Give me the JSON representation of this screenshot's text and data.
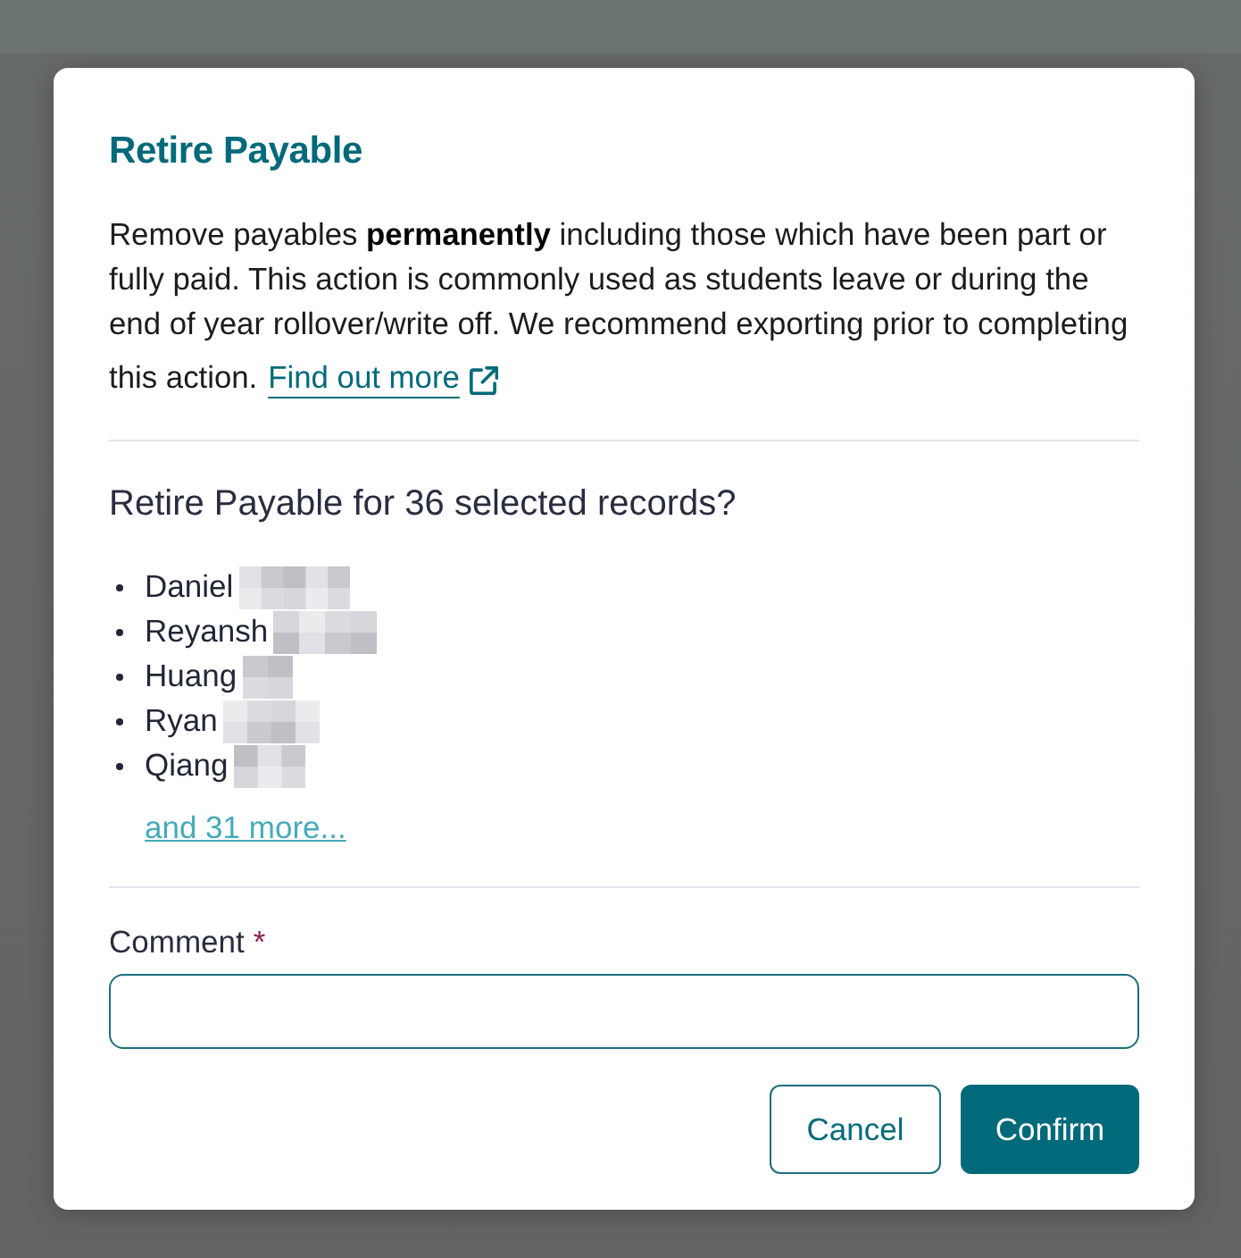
{
  "dialog": {
    "title": "Retire Payable",
    "description": "Remove payables **permanently** including those which have been part or fully paid. This action is commonly used as students leave or during the end of year rollover/write off. We recommend exporting prior to completing this action.",
    "link": {
      "label": "Find out more",
      "external": true
    },
    "question": "Retire Payable for 36 selected records?",
    "records": [
      {
        "name": "Daniel",
        "redacted": true
      },
      {
        "name": "Reyansh",
        "redacted": true
      },
      {
        "name": "Huang",
        "redacted": true
      },
      {
        "name": "Ryan",
        "redacted": true
      },
      {
        "name": "Qiang",
        "redacted": true
      }
    ],
    "more_link": "and 31 more...",
    "comment": {
      "label": "Comment",
      "required_mark": "*"
    },
    "buttons": [
      {
        "label": "Cancel",
        "kind": "secondary"
      },
      {
        "label": "Confirm",
        "kind": "primary"
      }
    ]
  }
}
